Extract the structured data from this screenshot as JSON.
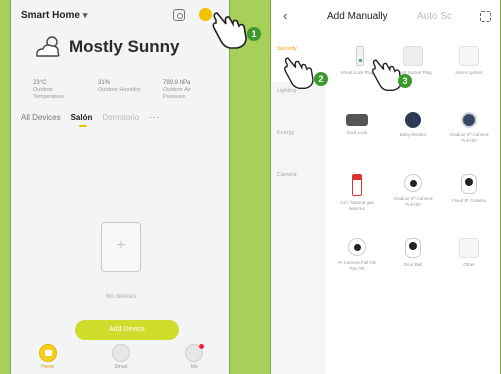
{
  "left_screen": {
    "home_title": "Smart Home",
    "caret": "▾",
    "weather_title": "Mostly Sunny",
    "weather_stats": [
      {
        "value": "23°C",
        "label": "Outdoor Temperature"
      },
      {
        "value": "31%",
        "label": "Outdoor Humidity"
      },
      {
        "value": "789.9 hPa",
        "label": "Outdoor Air Pressure"
      }
    ],
    "tabs": [
      "All Devices",
      "Salón",
      "Dormitorio",
      "···"
    ],
    "empty_text": "No devices",
    "add_device_label": "Add Device",
    "nav": [
      {
        "label": "Home",
        "icon": "home-icon"
      },
      {
        "label": "Smart",
        "icon": "smart-icon"
      },
      {
        "label": "Me",
        "icon": "profile-icon"
      }
    ]
  },
  "right_screen": {
    "back_icon": "‹",
    "tab_add_manually": "Add Manually",
    "tab_auto_scan": "Auto Sc",
    "categories": [
      "Security",
      "Lighting",
      "Energy",
      "Camera"
    ],
    "devices": [
      {
        "name": "Smart Lock Plug",
        "icon": "plug-icon",
        "img": "img-plug"
      },
      {
        "name": "Smart Socket Plug",
        "icon": "socket-icon",
        "img": "img-box"
      },
      {
        "name": "Alarm system",
        "icon": "alarm-icon",
        "img": "img-wbox"
      },
      {
        "name": "Door Lock",
        "icon": "door-lock-icon",
        "img": "img-lock"
      },
      {
        "name": "Baby Monitor",
        "icon": "baby-monitor-icon",
        "img": "img-ball"
      },
      {
        "name": "Outdoor IP Camera Full HD",
        "icon": "outdoor-camera-icon",
        "img": "img-ballw"
      },
      {
        "name": "CO / Natural gas detector",
        "icon": "gas-detector-icon",
        "img": "img-red"
      },
      {
        "name": "Outdoor IP Camera Full HD",
        "icon": "ip-camera-icon",
        "img": "img-cam"
      },
      {
        "name": "Fixed IP Camera",
        "icon": "fixed-camera-icon",
        "img": "img-camb"
      },
      {
        "name": "IP Camera Full HD Pan Tilt",
        "icon": "pan-tilt-camera-icon",
        "img": "img-cam"
      },
      {
        "name": "Door Bell",
        "icon": "doorbell-icon",
        "img": "img-camb"
      },
      {
        "name": "Other",
        "icon": "other-device-icon",
        "img": "img-wbox"
      }
    ]
  },
  "annotations": [
    "1",
    "2",
    "3"
  ],
  "colors": {
    "background": "#a8cf5a",
    "accent": "#f2c200",
    "button": "#cfdc2c",
    "step_badge": "#3a9a2a"
  }
}
